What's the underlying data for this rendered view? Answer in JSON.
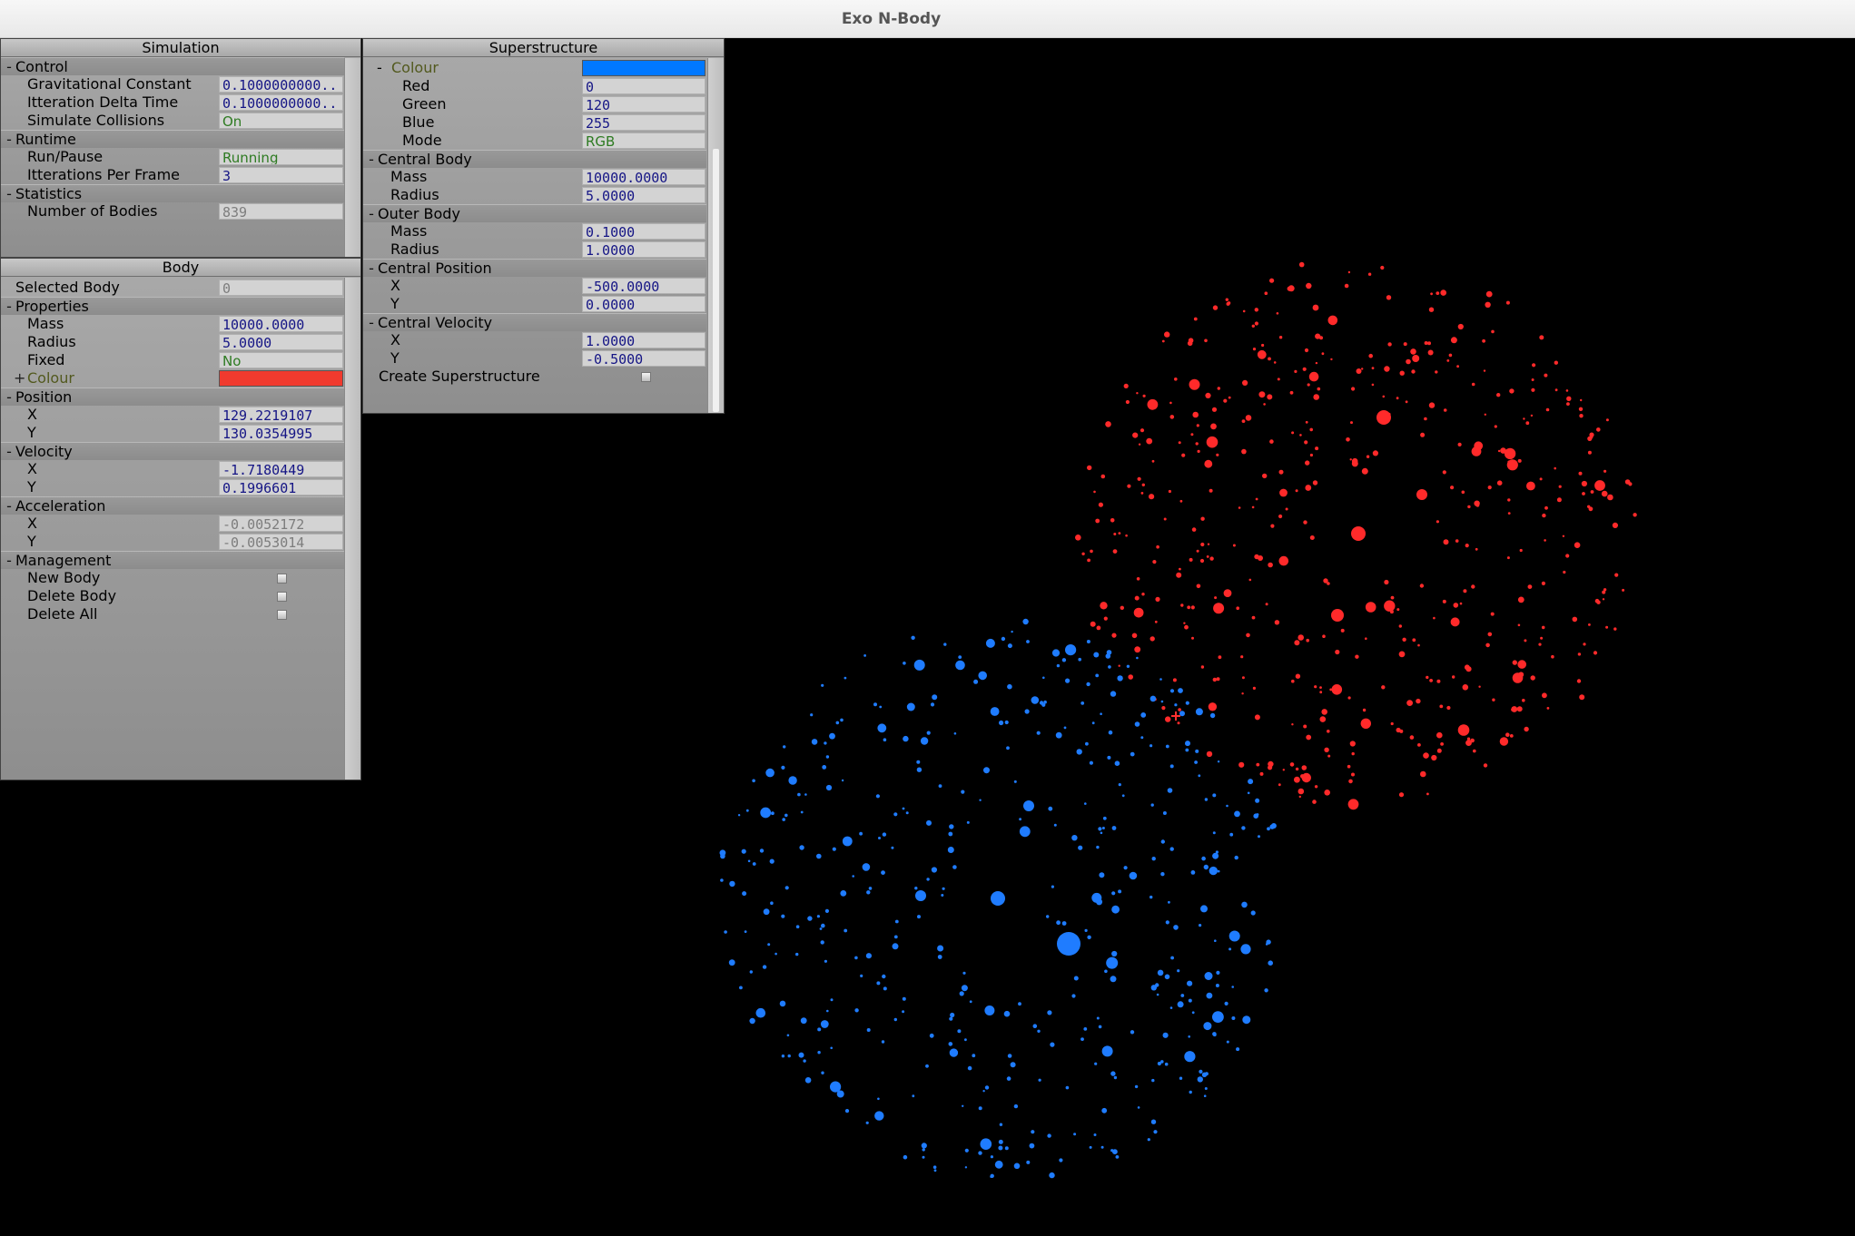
{
  "window": {
    "title": "Exo N-Body"
  },
  "simulation_panel": {
    "title": "Simulation",
    "sections": [
      {
        "name": "Control",
        "rows": [
          {
            "label": "Gravitational Constant",
            "value": "0.1000000000.."
          },
          {
            "label": "Itteration Delta Time",
            "value": "0.1000000000.."
          },
          {
            "label": "Simulate Collisions",
            "value": "On"
          }
        ]
      },
      {
        "name": "Runtime",
        "rows": [
          {
            "label": "Run/Pause",
            "value": "Running"
          },
          {
            "label": "Itterations Per Frame",
            "value": "3"
          }
        ]
      },
      {
        "name": "Statistics",
        "rows": [
          {
            "label": "Number of Bodies",
            "value": "839"
          }
        ]
      }
    ]
  },
  "body_panel": {
    "title": "Body",
    "selected_body": {
      "label": "Selected Body",
      "value": "0"
    },
    "properties": {
      "name": "Properties",
      "mass": {
        "label": "Mass",
        "value": "10000.0000"
      },
      "radius": {
        "label": "Radius",
        "value": "5.0000"
      },
      "fixed": {
        "label": "Fixed",
        "value": "No"
      },
      "colour": {
        "label": "Colour",
        "toggle": "+",
        "swatch": "#f03a2e"
      }
    },
    "position": {
      "name": "Position",
      "x_label": "X",
      "x": "129.2219107",
      "y_label": "Y",
      "y": "130.0354995"
    },
    "velocity": {
      "name": "Velocity",
      "x_label": "X",
      "x": "-1.7180449",
      "y_label": "Y",
      "y": "0.1996601"
    },
    "acceleration": {
      "name": "Acceleration",
      "x_label": "X",
      "x": "-0.0052172",
      "y_label": "Y",
      "y": "-0.0053014"
    },
    "management": {
      "name": "Management",
      "new_body": "New Body",
      "delete_body": "Delete Body",
      "delete_all": "Delete All"
    }
  },
  "superstructure_panel": {
    "title": "Superstructure",
    "colour": {
      "label": "Colour",
      "swatch": "#0078ff",
      "red_label": "Red",
      "red": "0",
      "green_label": "Green",
      "green": "120",
      "blue_label": "Blue",
      "blue": "255",
      "mode_label": "Mode",
      "mode": "RGB"
    },
    "central_body": {
      "name": "Central Body",
      "mass_label": "Mass",
      "mass": "10000.0000",
      "radius_label": "Radius",
      "radius": "5.0000"
    },
    "outer_body": {
      "name": "Outer Body",
      "mass_label": "Mass",
      "mass": "0.1000",
      "radius_label": "Radius",
      "radius": "1.0000"
    },
    "central_position": {
      "name": "Central Position",
      "x_label": "X",
      "x": "-500.0000",
      "y_label": "Y",
      "y": "0.0000"
    },
    "central_velocity": {
      "name": "Central Velocity",
      "x_label": "X",
      "x": "1.0000",
      "y_label": "Y",
      "y": "-0.5000"
    },
    "create": "Create Superstructure"
  },
  "colors": {
    "red_cluster": "#ff2a2a",
    "blue_cluster": "#1f7cff",
    "background": "#000000"
  }
}
